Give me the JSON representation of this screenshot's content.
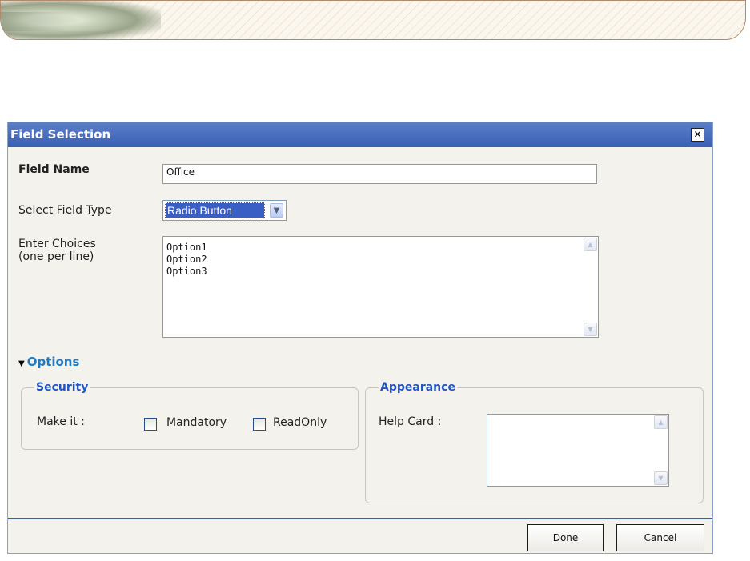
{
  "dialog": {
    "title": "Field Selection",
    "close_icon": "close-icon"
  },
  "field_name": {
    "label": "Field Name",
    "value": "Office"
  },
  "field_type": {
    "label": "Select Field Type",
    "selected": "Radio Button"
  },
  "choices": {
    "label_line1": "Enter Choices",
    "label_line2": "(one per line)",
    "lines": [
      "Option1",
      "Option2",
      "Option3"
    ]
  },
  "options": {
    "label": "Options",
    "expanded": true
  },
  "security": {
    "legend": "Security",
    "make_it_label": "Make it :",
    "mandatory_label": "Mandatory",
    "mandatory_checked": false,
    "readonly_label": "ReadOnly",
    "readonly_checked": false
  },
  "appearance": {
    "legend": "Appearance",
    "help_card_label": "Help Card :",
    "help_card_value": ""
  },
  "buttons": {
    "done": "Done",
    "cancel": "Cancel"
  },
  "colors": {
    "titlebar": "#3a60b4",
    "legend_text": "#2053c4",
    "options_link": "#1f7ac4",
    "dialog_bg": "#f3f2ec"
  }
}
